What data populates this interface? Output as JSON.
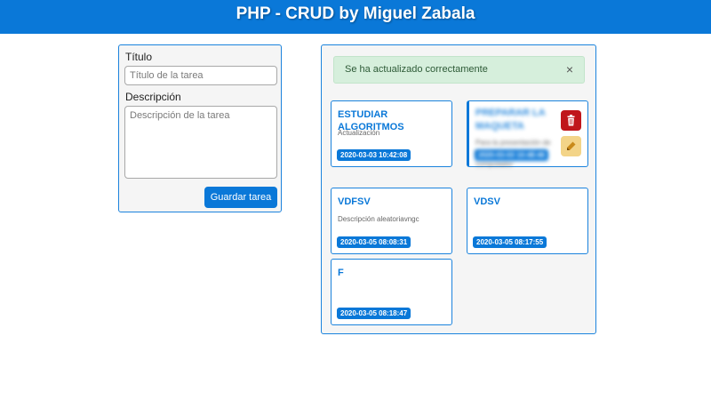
{
  "header": {
    "title": "PHP - CRUD by Miguel Zabala"
  },
  "form": {
    "title_label": "Título",
    "title_placeholder": "Título de la tarea",
    "desc_label": "Descripción",
    "desc_placeholder": "Descripción de la tarea",
    "save_label": "Guardar tarea"
  },
  "alert": {
    "message": "Se ha actualizado correctamente",
    "close": "×"
  },
  "tasks": [
    {
      "title": "ESTUDIAR ALGORITMOS",
      "description": "Actualización",
      "date": "2020-03-03 10:42:08"
    },
    {
      "title": "PREPARAR LA MAQUETA",
      "description": "Para la presentación de las partes internas del computador",
      "date": "2020-03-03 10:48:46"
    },
    {
      "title": "VDFSV",
      "description": "Descripción aleatoriavngc",
      "date": "2020-03-05 08:08:31"
    },
    {
      "title": "VDSV",
      "description": "",
      "date": "2020-03-05 08:17:55"
    },
    {
      "title": "F",
      "description": "",
      "date": "2020-03-05 08:18:47"
    }
  ],
  "icons": {
    "delete": "trash-icon",
    "edit": "pencil-icon"
  },
  "colors": {
    "primary": "#0a78d8",
    "danger": "#c0161b",
    "warning": "#f3d488",
    "success_bg": "#d6efdc"
  }
}
